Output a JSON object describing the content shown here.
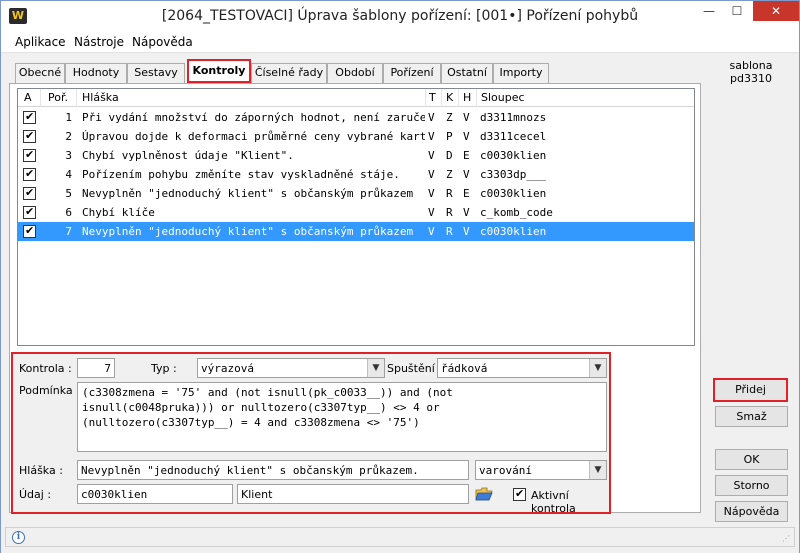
{
  "window": {
    "title": "[2064_TESTOVACI] Úprava šablony pořízení: [001•] Pořízení pohybů",
    "app_icon": "W"
  },
  "menu": [
    "Aplikace",
    "Nástroje",
    "Nápověda"
  ],
  "tabs": [
    "Obecné",
    "Hodnoty",
    "Sestavy",
    "Kontroly",
    "Číselné řady",
    "Období",
    "Pořízení",
    "Ostatní",
    "Importy"
  ],
  "active_tab": "Kontroly",
  "sidebar": {
    "template_label": "sablona",
    "template_name": "pd3310",
    "buttons": {
      "add": "Přidej",
      "delete": "Smaž",
      "ok": "OK",
      "cancel": "Storno",
      "help": "Nápověda"
    }
  },
  "grid": {
    "headers": {
      "active": "A",
      "order": "Poř.",
      "message": "Hláška",
      "t": "T",
      "k": "K",
      "h": "H",
      "column": "Sloupec"
    },
    "rows": [
      {
        "order": "1",
        "message": "Při vydání množství do záporných hodnot, není zaručen",
        "t": "V",
        "k": "Z",
        "h": "V",
        "column": "d3311mnozs"
      },
      {
        "order": "2",
        "message": "Úpravou dojde k deformaci průměrné ceny vybrané karty",
        "t": "V",
        "k": "P",
        "h": "V",
        "column": "d3311cecel"
      },
      {
        "order": "3",
        "message": "Chybí vyplněnost údaje \"Klient\".",
        "t": "V",
        "k": "D",
        "h": "E",
        "column": "c0030klien"
      },
      {
        "order": "4",
        "message": "Pořízením pohybu změníte stav vyskladněné stáje.",
        "t": "V",
        "k": "Z",
        "h": "V",
        "column": "c3303dp___"
      },
      {
        "order": "5",
        "message": "Nevyplněn \"jednoduchý klient\" s občanským průkazem",
        "t": "V",
        "k": "R",
        "h": "E",
        "column": "c0030klien"
      },
      {
        "order": "6",
        "message": "Chybí klíče",
        "t": "V",
        "k": "R",
        "h": "V",
        "column": "c_komb_code"
      },
      {
        "order": "7",
        "message": "Nevyplněn \"jednoduchý klient\" s občanským průkazem",
        "t": "V",
        "k": "R",
        "h": "V",
        "column": "c0030klien"
      }
    ]
  },
  "detail": {
    "kontrola_label": "Kontrola :",
    "kontrola_value": "7",
    "typ_label": "Typ :",
    "typ_value": "výrazová",
    "spusteni_label": "Spuštění :",
    "spusteni_value": "řádková",
    "podminka_label": "Podmínka :",
    "podminka_value": "(c3308zmena = '75' and (not isnull(pk_c0033__)) and (not\nisnull(c0048pruka))) or nulltozero(c3307typ__) <> 4 or\n(nulltozero(c3307typ__) = 4 and c3308zmena <> '75')",
    "hlaska_label": "Hláška :",
    "hlaska_value": "Nevyplněn \"jednoduchý klient\" s občanským průkazem.",
    "hlaska_level": "varování",
    "udaj_label": "Údaj :",
    "udaj_value": "c0030klien",
    "udaj_desc": "Klient",
    "active_label": "Aktivní kontrola"
  },
  "colors": {
    "highlight_border": "#e0212a",
    "selection": "#3399ff",
    "close_button": "#c7352b"
  }
}
